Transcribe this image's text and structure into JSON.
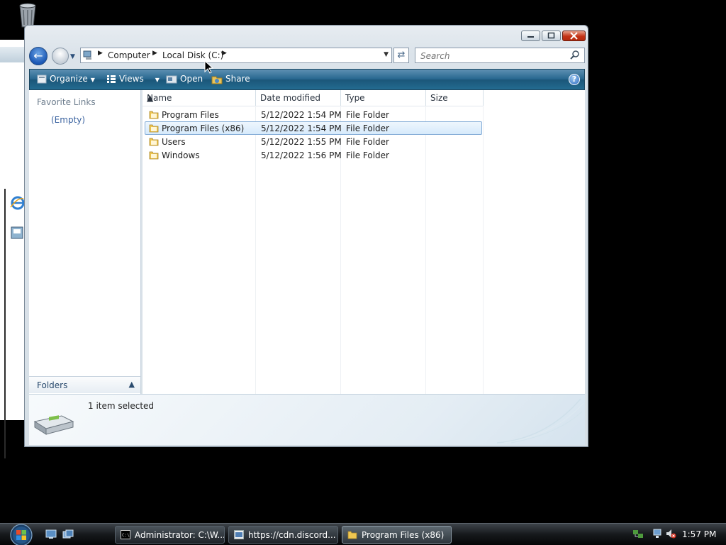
{
  "window": {
    "title_buttons": [
      "minimize",
      "maximize",
      "close"
    ]
  },
  "nav": {
    "breadcrumb": [
      "Computer",
      "Local Disk (C:)"
    ],
    "search_placeholder": "Search"
  },
  "commandbar": {
    "organize": "Organize",
    "views": "Views",
    "open": "Open",
    "share": "Share",
    "help": "?"
  },
  "leftpane": {
    "favorite_links_title": "Favorite Links",
    "favorite_links_empty": "(Empty)",
    "folders_label": "Folders"
  },
  "filelist": {
    "columns": [
      "Name",
      "Date modified",
      "Type",
      "Size"
    ],
    "rows": [
      {
        "name": "Program Files",
        "date": "5/12/2022 1:54 PM",
        "type": "File Folder",
        "size": ""
      },
      {
        "name": "Program Files (x86)",
        "date": "5/12/2022 1:54 PM",
        "type": "File Folder",
        "size": "",
        "selected": true
      },
      {
        "name": "Users",
        "date": "5/12/2022 1:55 PM",
        "type": "File Folder",
        "size": ""
      },
      {
        "name": "Windows",
        "date": "5/12/2022 1:56 PM",
        "type": "File Folder",
        "size": ""
      }
    ]
  },
  "status": {
    "selection": "1 item selected"
  },
  "taskbar": {
    "tasks": [
      {
        "label": "Administrator: C:\\W...",
        "icon": "cmd-icon"
      },
      {
        "label": "https://cdn.discord...",
        "icon": "browser-icon"
      },
      {
        "label": "Program Files (x86)",
        "icon": "folder-icon",
        "active": true
      }
    ],
    "clock": "1:57 PM"
  },
  "colors": {
    "accent": "#27678f",
    "selection_border": "#84acd7",
    "selection_fill": "#d6eafb",
    "link_blue": "#3b63a0"
  }
}
